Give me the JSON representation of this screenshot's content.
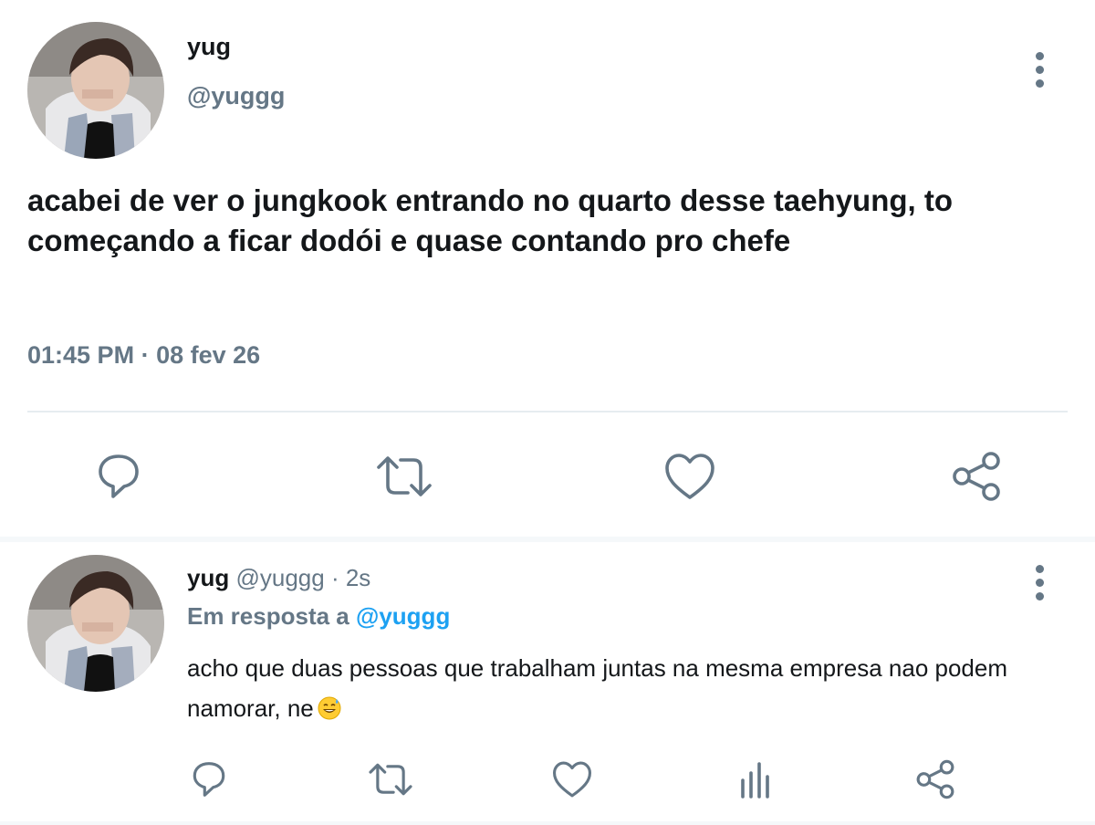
{
  "main_tweet": {
    "name": "yug",
    "handle": "@yuggg",
    "text": "acabei de ver o jungkook entrando no quarto desse taehyung, to começando a ficar dodói e quase contando pro chefe",
    "time": "01:45 PM",
    "separator": "·",
    "date": "08 fev 26",
    "actions": [
      "reply-icon",
      "retweet-icon",
      "like-icon",
      "share-icon"
    ]
  },
  "reply_tweet": {
    "name": "yug",
    "handle": "@yuggg",
    "dot": "·",
    "age": "2s",
    "in_reply_prefix": "Em resposta a",
    "in_reply_handle": "@yuggg",
    "text": "acho que duas pessoas que trabalham juntas na mesma empresa nao podem namorar, ne",
    "emoji": "grinning-sweat-emoji",
    "actions": [
      "reply-icon",
      "retweet-icon",
      "like-icon",
      "analytics-icon",
      "share-icon"
    ]
  },
  "colors": {
    "text": "#14171a",
    "muted": "#657786",
    "link": "#1da1f2",
    "divider": "#e6ecf0"
  }
}
